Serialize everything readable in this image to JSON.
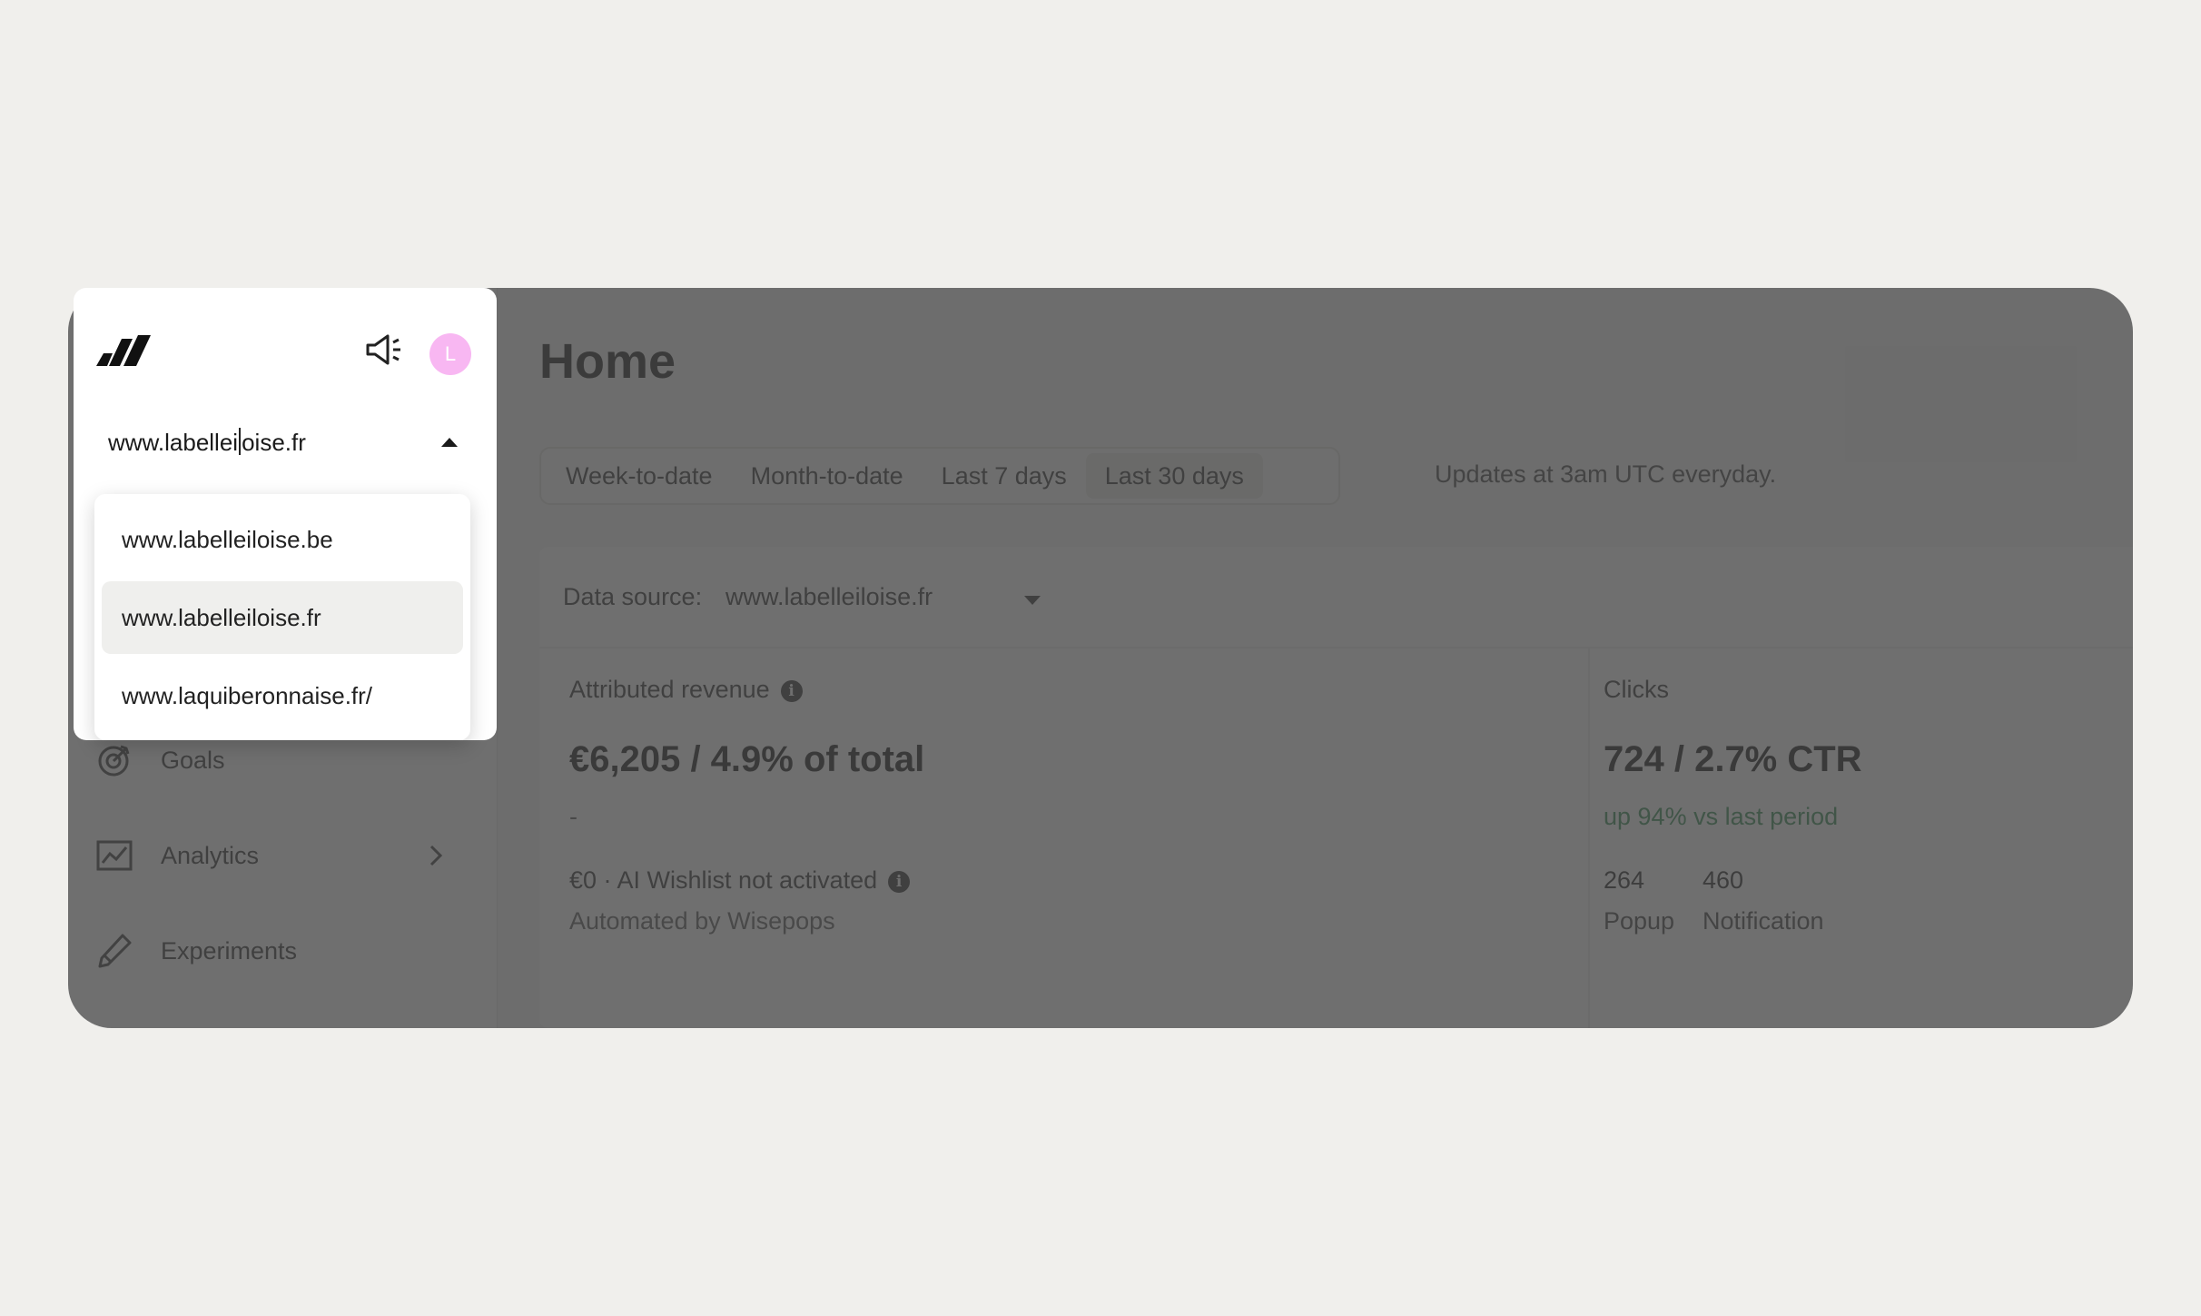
{
  "app": {
    "avatar_initial": "L",
    "selected_site_prefix": "www.labellei",
    "selected_site_suffix": "oise.fr"
  },
  "site_dropdown": {
    "options": [
      "www.labelleiloise.be",
      "www.labelleiloise.fr",
      "www.laquiberonnaise.fr/"
    ],
    "selected_index": 1
  },
  "sidebar": {
    "items": [
      {
        "label": "Goals",
        "icon": "target-icon"
      },
      {
        "label": "Analytics",
        "icon": "chart-line-icon",
        "has_chevron": true
      },
      {
        "label": "Experiments",
        "icon": "flask-icon"
      }
    ]
  },
  "main": {
    "title": "Home",
    "date_ranges": [
      "Week-to-date",
      "Month-to-date",
      "Last 7 days",
      "Last 30 days"
    ],
    "active_range": "Last 30 days",
    "updates_note": "Updates at 3am UTC everyday.",
    "data_source_label": "Data source:",
    "data_source_value": "www.labelleiloise.fr",
    "attributed": {
      "label": "Attributed revenue",
      "value": "€6,205 / 4.9% of total",
      "delta": "-",
      "wishlist": "€0 · AI Wishlist not activated",
      "automated": "Automated by Wisepops"
    },
    "clicks": {
      "label": "Clicks",
      "value": "724 / 2.7% CTR",
      "delta": "up 94% vs last period",
      "popup_count": "264",
      "popup_label": "Popup",
      "notification_count": "460",
      "notification_label": "Notification"
    }
  },
  "colors": {
    "background": "#f0efec",
    "overlay": "#5a5a5a",
    "avatar": "#f8b7f2",
    "positive": "#2e8a4f"
  }
}
